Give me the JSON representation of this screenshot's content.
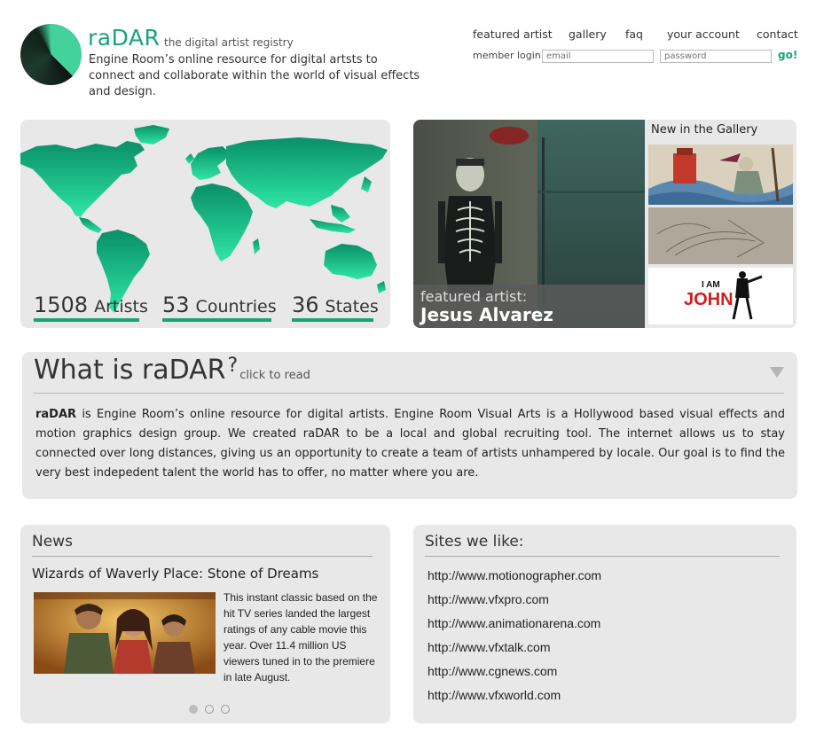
{
  "header": {
    "logo_text": "raDAR",
    "tagline": "the digital artist registry",
    "description": "Engine Room’s online resource for digital artsts to connect and collaborate within the world of visual effects and design."
  },
  "nav": [
    "featured artist",
    "gallery",
    "faq",
    "your account",
    "contact"
  ],
  "login": {
    "label": "member login:",
    "email_placeholder": "email",
    "password_placeholder": "password",
    "go_label": "go!"
  },
  "stats": [
    {
      "number": "1508",
      "label": "Artists"
    },
    {
      "number": "53",
      "label": "Countries"
    },
    {
      "number": "36",
      "label": "States"
    }
  ],
  "featured": {
    "caption": "featured artist:",
    "name": "Jesus Alvarez"
  },
  "gallery": {
    "title": "New in the Gallery",
    "thumb3_text_a": "I AM",
    "thumb3_text_b": "JOHN"
  },
  "about": {
    "title": "What is raDAR",
    "question_mark": "?",
    "hint": "click to read",
    "body_bold": "raDAR",
    "body_rest": " is Engine Room’s online resource for digital artists.  Engine Room Visual Arts is a Hollywood based visual effects and motion graphics design group.  We created raDAR to be a local and global recruiting tool.  The internet allows us to stay connected over long distances, giving us an opportunity to create a team of artists unhampered by locale.  Our goal is to find the very best indepedent talent the world has to offer, no matter where you are."
  },
  "news": {
    "title": "News",
    "headline": "Wizards of Waverly Place: Stone of Dreams",
    "body": "This instant classic based on the hit TV series landed the largest ratings of any cable movie this year.  Over 11.4 million US viewers tuned in to the premiere in late August.",
    "slides_total": 3,
    "slide_active": 1
  },
  "sites": {
    "title": "Sites we like:",
    "links": [
      "http://www.motionographer.com",
      "http://www.vfxpro.com",
      "http://www.animationarena.com",
      "http://www.vfxtalk.com",
      "http://www.cgnews.com",
      "http://www.vfxworld.com"
    ]
  },
  "colors": {
    "brand_green": "#1aa37a",
    "panel_gray": "#e8e8e8"
  }
}
